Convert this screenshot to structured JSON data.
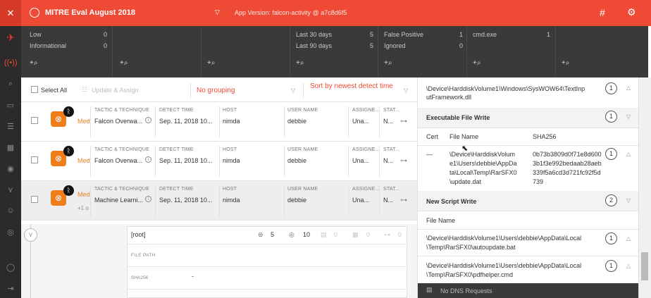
{
  "header": {
    "close_icon": "close-icon",
    "title": "MITRE Eval August 2018",
    "version_label": "App Version: falcon-activity @ a7c8d6f5",
    "grid_icon": "grid-icon",
    "settings_icon": "gear-icon"
  },
  "stats": {
    "col1": [
      {
        "label": "Low",
        "value": "0"
      },
      {
        "label": "Informational",
        "value": "0"
      }
    ],
    "col4": [
      {
        "label": "Last 30 days",
        "value": "5"
      },
      {
        "label": "Last 90 days",
        "value": "5"
      }
    ],
    "col5": [
      {
        "label": "False Positive",
        "value": "1"
      },
      {
        "label": "Ignored",
        "value": "0"
      }
    ],
    "col6": [
      {
        "label": "cmd.exe",
        "value": "1"
      }
    ],
    "add_label": "+"
  },
  "toolbar": {
    "select_all": "Select All",
    "update_assign": "Update & Assign",
    "grouping": "No grouping",
    "sort": "Sort by newest detect time"
  },
  "detection_headers": {
    "tactic": "TACTIC & TECHNIQUE",
    "detect_time": "DETECT TIME",
    "host": "HOST",
    "user": "USER NAME",
    "assignee": "ASSIGNE...",
    "status": "STAT..."
  },
  "detections": [
    {
      "severity": "Med",
      "tactic": "Falcon Overwa...",
      "time": "Sep. 11, 2018 10...",
      "host": "nimda",
      "user": "debbie",
      "assignee": "Una...",
      "status": "N...",
      "more": ""
    },
    {
      "severity": "Med",
      "tactic": "Falcon Overwa...",
      "time": "Sep. 11, 2018 10...",
      "host": "nimda",
      "user": "debbie",
      "assignee": "Una...",
      "status": "N...",
      "more": ""
    },
    {
      "severity": "Med",
      "tactic": "Machine Learni...",
      "time": "Sep. 11, 2018 10...",
      "host": "nimda",
      "user": "debbie",
      "assignee": "Una...",
      "status": "N...",
      "more": "+1 o"
    }
  ],
  "process": {
    "root": "[root]",
    "stat1": "5",
    "stat2": "10",
    "stat3": "0",
    "stat4": "0",
    "stat5": "0",
    "file_path_label": "FILE PATH",
    "sha256_label": "SHA256",
    "sha256_value": "-"
  },
  "panel": {
    "top_path_l1": "\\Device\\HarddiskVolume1\\Windows\\SysWOW64\\TextInp",
    "top_path_l2": "utFramework.dll",
    "top_count": "1",
    "exec_title": "Executable File Write",
    "exec_count": "1",
    "col_cert": "Cert",
    "col_file": "File Name",
    "col_sha": "SHA256",
    "cert_dash": "—",
    "exec_file": [
      "\\Device\\HarddiskVolum",
      "e1\\Users\\debbie\\AppDa",
      "ta\\Local\\Temp\\RarSFX0",
      "\\update.dat"
    ],
    "exec_sha": [
      "0b73b3809d0f71e8d600",
      "3b1f3e992bedaab28aeb",
      "339f5a6cd3d721fc92f5d",
      "739"
    ],
    "exec_row_count": "1",
    "script_title": "New Script Write",
    "script_count": "2",
    "file_name_label": "File Name",
    "script_files": [
      {
        "l1": "\\Device\\HarddiskVolume1\\Users\\debbie\\AppData\\Local",
        "l2": "\\Temp\\RarSFX0\\autoupdate.bat",
        "count": "1"
      },
      {
        "l1": "\\Device\\HarddiskVolume1\\Users\\debbie\\AppData\\Local",
        "l2": "\\Temp\\RarSFX0\\pdfhelper.cmd",
        "count": "1"
      }
    ],
    "dns": "No DNS Requests"
  }
}
